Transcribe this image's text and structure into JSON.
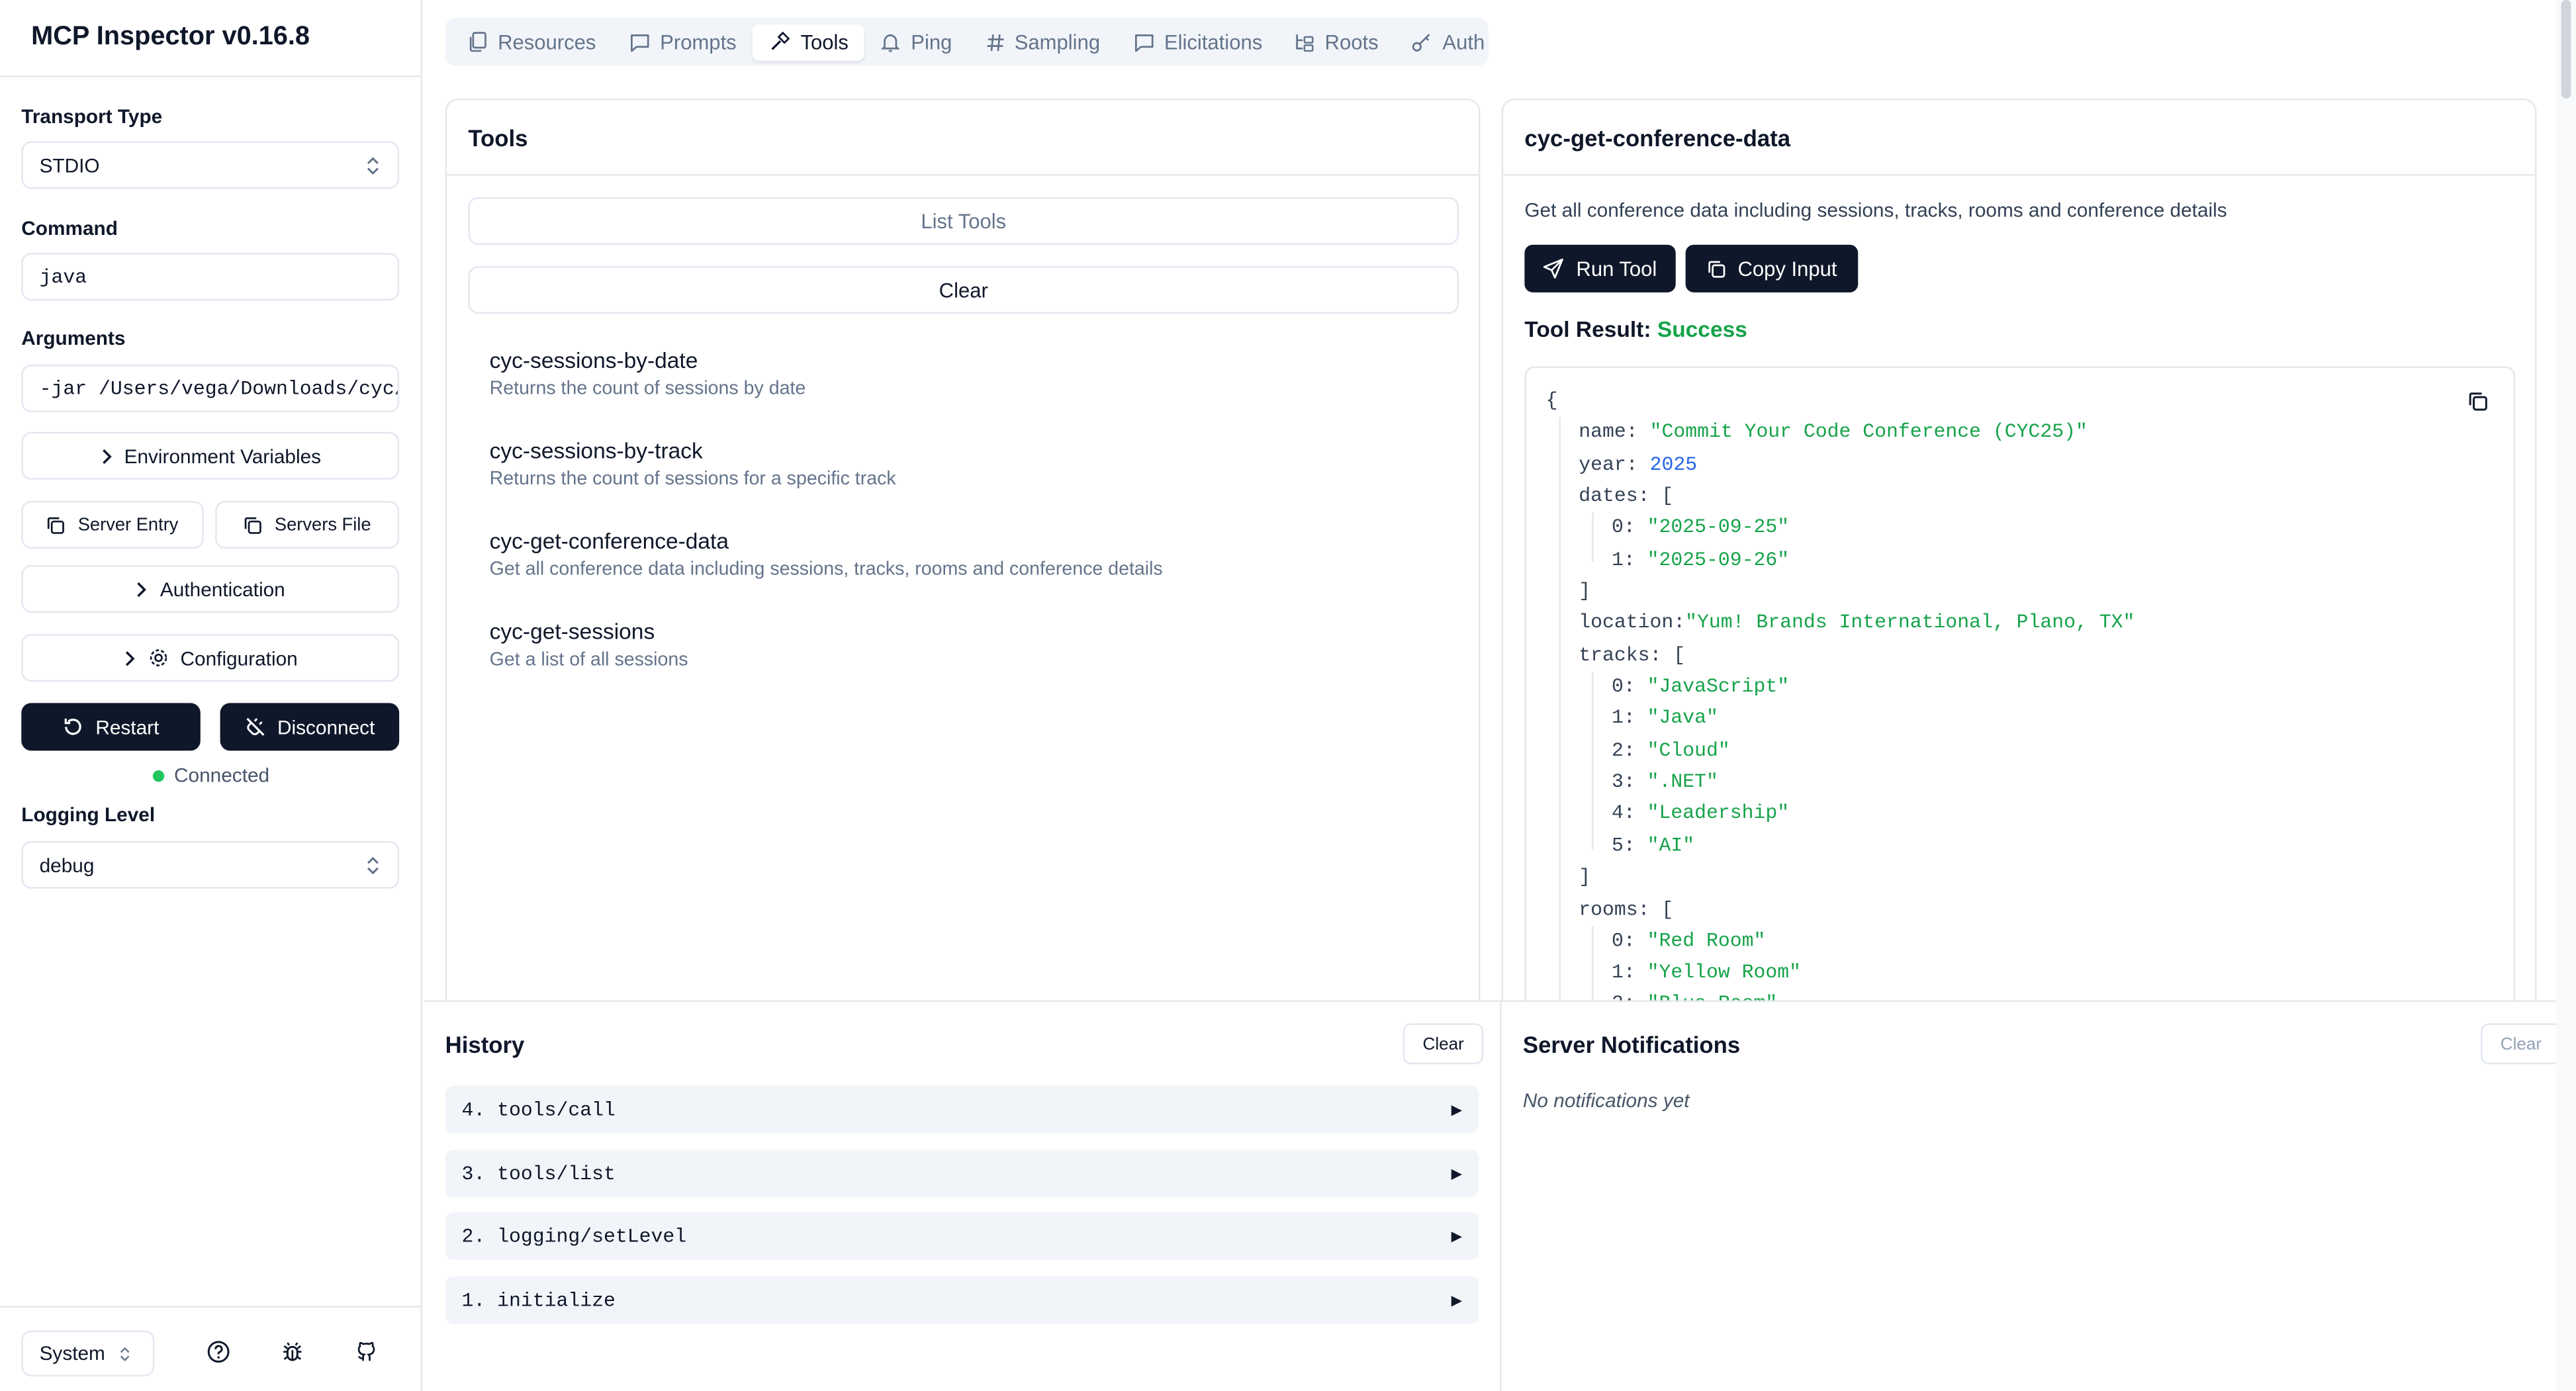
{
  "app": {
    "title": "MCP Inspector v0.16.8"
  },
  "sidebar": {
    "transport_label": "Transport Type",
    "transport_value": "STDIO",
    "command_label": "Command",
    "command_value": "java",
    "arguments_label": "Arguments",
    "arguments_value": "-jar /Users/vega/Downloads/cyc/",
    "env_vars_label": "Environment Variables",
    "server_entry_label": "Server Entry",
    "servers_file_label": "Servers File",
    "authentication_label": "Authentication",
    "configuration_label": "Configuration",
    "restart_label": "Restart",
    "disconnect_label": "Disconnect",
    "status_text": "Connected",
    "logging_label": "Logging Level",
    "logging_value": "debug",
    "theme_value": "System"
  },
  "tabs": [
    {
      "label": "Resources",
      "icon": "files-icon"
    },
    {
      "label": "Prompts",
      "icon": "message-icon"
    },
    {
      "label": "Tools",
      "icon": "hammer-icon",
      "active": true
    },
    {
      "label": "Ping",
      "icon": "bell-icon"
    },
    {
      "label": "Sampling",
      "icon": "hash-icon"
    },
    {
      "label": "Elicitations",
      "icon": "message-square-icon"
    },
    {
      "label": "Roots",
      "icon": "folder-tree-icon"
    },
    {
      "label": "Auth",
      "icon": "key-icon"
    }
  ],
  "tools_panel": {
    "title": "Tools",
    "list_button": "List Tools",
    "clear_button": "Clear",
    "items": [
      {
        "name": "cyc-sessions-by-date",
        "description": "Returns the count of sessions by date"
      },
      {
        "name": "cyc-sessions-by-track",
        "description": "Returns the count of sessions for a specific track"
      },
      {
        "name": "cyc-get-conference-data",
        "description": "Get all conference data including sessions, tracks, rooms and conference details"
      },
      {
        "name": "cyc-get-sessions",
        "description": "Get a list of all sessions"
      }
    ]
  },
  "detail_panel": {
    "title": "cyc-get-conference-data",
    "description": "Get all conference data including sessions, tracks, rooms and conference details",
    "run_button": "Run Tool",
    "copy_button": "Copy Input",
    "result_label": "Tool Result:",
    "result_status": "Success",
    "json": {
      "open": "{",
      "name_key": "name:",
      "name_val": "\"Commit Your Code Conference (CYC25)\"",
      "year_key": "year:",
      "year_val": "2025",
      "dates_key": "dates: [",
      "dates": [
        "\"2025-09-25\"",
        "\"2025-09-26\""
      ],
      "close_bracket": "]",
      "location_key": "location:",
      "location_val": "\"Yum! Brands International, Plano, TX\"",
      "tracks_key": "tracks: [",
      "tracks": [
        "\"JavaScript\"",
        "\"Java\"",
        "\"Cloud\"",
        "\".NET\"",
        "\"Leadership\"",
        "\"AI\""
      ],
      "rooms_key": "rooms: [",
      "rooms": [
        "\"Red Room\"",
        "\"Yellow Room\"",
        "\"Blue Room\""
      ]
    }
  },
  "history": {
    "title": "History",
    "clear_button": "Clear",
    "items": [
      "4. tools/call",
      "3. tools/list",
      "2. logging/setLevel",
      "1. initialize"
    ]
  },
  "notifications": {
    "title": "Server Notifications",
    "clear_button": "Clear",
    "empty_text": "No notifications yet"
  }
}
